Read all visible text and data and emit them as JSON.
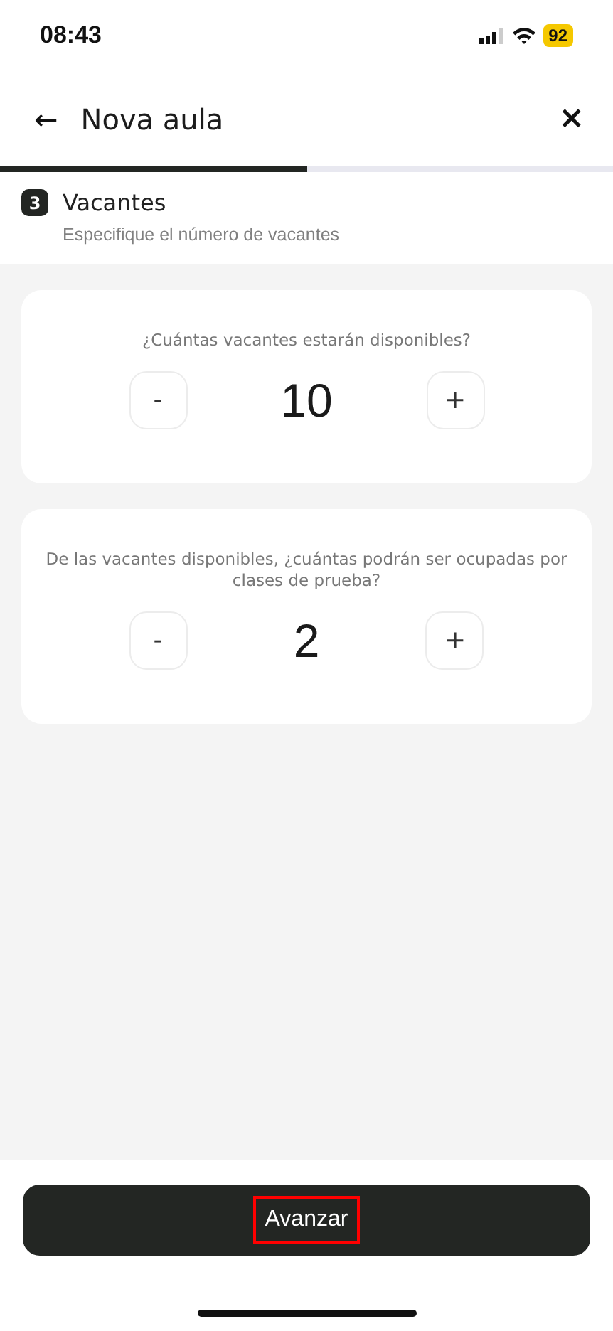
{
  "status_bar": {
    "time": "08:43",
    "battery": "92"
  },
  "header": {
    "back": "←",
    "title": "Nova aula",
    "close": "×"
  },
  "progress": {
    "level": 0.5
  },
  "step": {
    "number": "3",
    "title": "Vacantes",
    "subtitle": "Especifique el número de vacantes"
  },
  "counters": [
    {
      "question": "¿Cuántas vacantes estarán disponibles?",
      "minus": "-",
      "value": "10",
      "plus": "+"
    },
    {
      "question": "De las vacantes disponibles, ¿cuántas podrán ser ocupadas por clases de prueba?",
      "minus": "-",
      "value": "2",
      "plus": "+"
    }
  ],
  "footer": {
    "button": "Avanzar",
    "highlighted": true
  }
}
